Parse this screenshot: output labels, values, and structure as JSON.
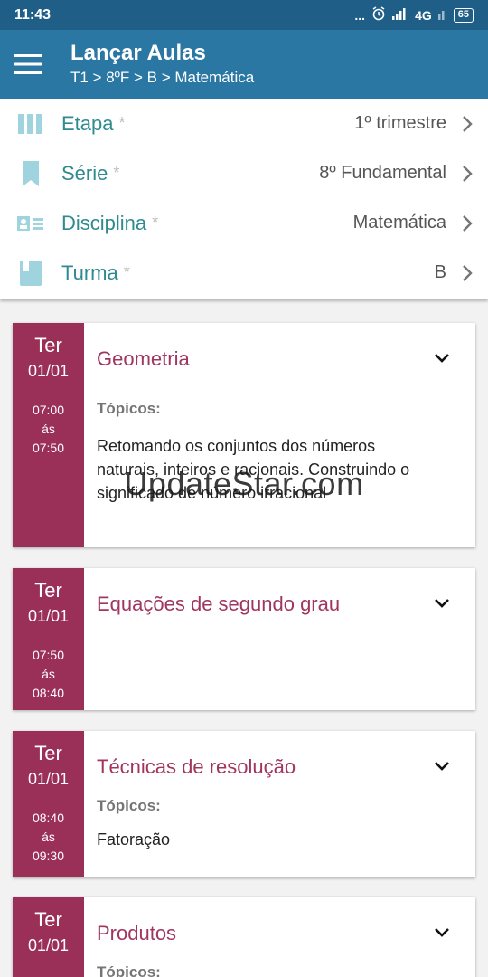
{
  "statusbar": {
    "time": "11:43",
    "dots": "...",
    "network": "4G",
    "battery": "65"
  },
  "appbar": {
    "title": "Lançar Aulas",
    "subtitle": "T1 > 8ºF > B > Matemática"
  },
  "filters": [
    {
      "label": "Etapa",
      "required": "*",
      "value": "1º trimestre",
      "icon": "columns-icon"
    },
    {
      "label": "Série",
      "required": "*",
      "value": "8º Fundamental",
      "icon": "bookmark-icon"
    },
    {
      "label": "Disciplina",
      "required": "*",
      "value": "Matemática",
      "icon": "id-card-icon"
    },
    {
      "label": "Turma",
      "required": "*",
      "value": "B",
      "icon": "book-icon"
    }
  ],
  "lessons": [
    {
      "day": "Ter",
      "date": "01/01",
      "start": "07:00",
      "sep": "ás",
      "end": "07:50",
      "title": "Geometria",
      "topics_label": "Tópicos:",
      "topics": "Retomando os conjuntos dos números naturais, inteiros e racionais. Construindo o significado de número irracional"
    },
    {
      "day": "Ter",
      "date": "01/01",
      "start": "07:50",
      "sep": "ás",
      "end": "08:40",
      "title": "Equações de segundo grau"
    },
    {
      "day": "Ter",
      "date": "01/01",
      "start": "08:40",
      "sep": "ás",
      "end": "09:30",
      "title": "Técnicas de resolução",
      "topics_label": "Tópicos:",
      "topics": "Fatoração"
    },
    {
      "day": "Ter",
      "date": "01/01",
      "title": "Produtos",
      "topics_label": "Tópicos:"
    }
  ],
  "watermark": "UpdateStar.com",
  "colors": {
    "statusbar": "#1f5f87",
    "appbar": "#2a77a4",
    "accent_teal": "#2e8b8f",
    "lesson_side": "#9a2f57",
    "lesson_title": "#a0365f"
  }
}
